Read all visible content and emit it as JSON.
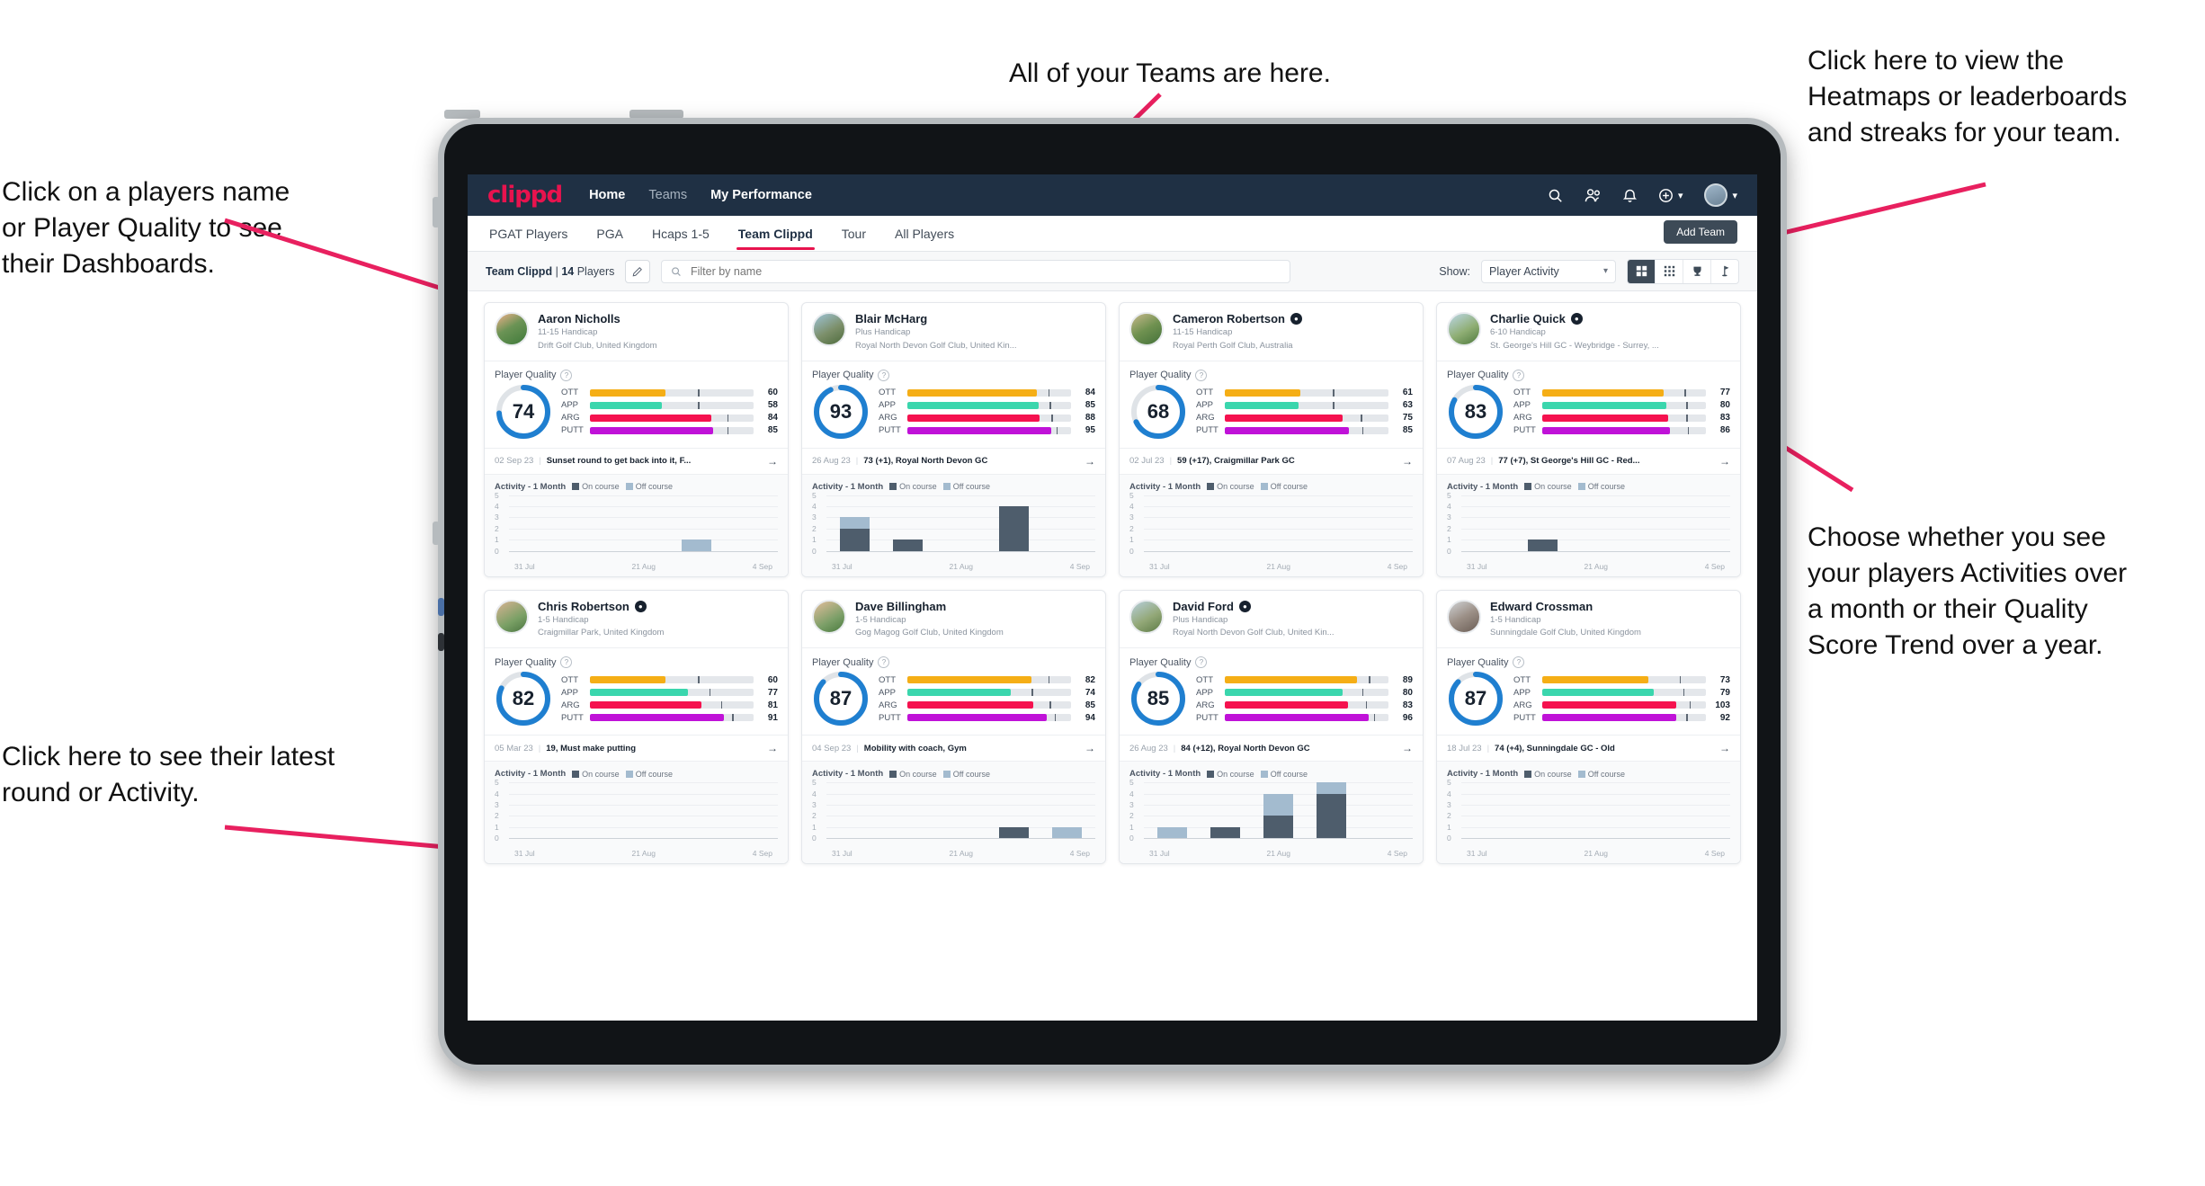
{
  "annotations": [
    {
      "id": "teams",
      "text": "All of your Teams are here."
    },
    {
      "id": "heatmaps",
      "text": "Click here to view the\nHeatmaps or leaderboards\nand streaks for your team."
    },
    {
      "id": "players",
      "text": "Click on a players name\nor Player Quality to see\ntheir Dashboards."
    },
    {
      "id": "choose",
      "text": "Choose whether you see\nyour players Activities over\na month or their Quality\nScore Trend over a year."
    },
    {
      "id": "latest",
      "text": "Click here to see their latest\nround or Activity."
    }
  ],
  "app": {
    "brand": "clippd",
    "brand_color": "#e8134e",
    "header_bg": "#1f3044",
    "nav": [
      {
        "label": "Home",
        "active": true
      },
      {
        "label": "Teams",
        "active": false
      },
      {
        "label": "My Performance",
        "active": false
      }
    ],
    "header_icons": [
      {
        "name": "search-icon",
        "glyph": "⌕"
      },
      {
        "name": "people-icon",
        "glyph": "\u0000"
      },
      {
        "name": "bell-icon",
        "glyph": "\u0000"
      },
      {
        "name": "add-circle-icon",
        "glyph": "\u0000"
      },
      {
        "name": "avatar",
        "glyph": "\u0000"
      }
    ],
    "tabs": [
      {
        "label": "PGAT Players",
        "active": false
      },
      {
        "label": "PGA",
        "active": false
      },
      {
        "label": "Hcaps 1-5",
        "active": false
      },
      {
        "label": "Team Clippd",
        "active": true
      },
      {
        "label": "Tour",
        "active": false
      },
      {
        "label": "All Players",
        "active": false
      }
    ],
    "add_team_label": "Add Team",
    "filter": {
      "team_name": "Team Clippd",
      "separator": "|",
      "player_count": "14",
      "players_word": "Players",
      "search_placeholder": "Filter by name",
      "search_value": "",
      "show_label": "Show:",
      "show_selected": "Player Activity",
      "show_options": [
        "Player Activity",
        "Quality Score Trend"
      ],
      "view_modes": [
        {
          "name": "grid-large-icon",
          "active": true
        },
        {
          "name": "grid-small-icon",
          "active": false
        },
        {
          "name": "trophy-icon",
          "active": false
        },
        {
          "name": "flag-icon",
          "active": false
        }
      ]
    },
    "card_labels": {
      "player_quality": "Player Quality",
      "activity": "Activity - 1 Month",
      "legend_on": "On course",
      "legend_off": "Off course",
      "y_ticks": [
        "5",
        "4",
        "3",
        "2",
        "1",
        "0"
      ],
      "x_ticks": [
        "31 Jul",
        "21 Aug",
        "4 Sep"
      ],
      "metric_order": [
        "OTT",
        "APP",
        "ARG",
        "PUTT"
      ],
      "metric_colors": {
        "OTT": "#f5ae16",
        "APP": "#3ad6ad",
        "ARG": "#f5124f",
        "PUTT": "#c012d8"
      },
      "on_course_color": "#4e5d6c",
      "off_course_color": "#a3bbcf",
      "ring_color": "#1f7fd0",
      "ring_track": "#dfe3e7"
    }
  },
  "players": [
    {
      "name": "Aaron Nicholls",
      "verified": false,
      "handicap": "11-15 Handicap",
      "club": "Drift Golf Club, United Kingdom",
      "avatar": "linear-gradient(150deg,#f0b08a 0%,#6b9355 45%,#3f7a3a 100%)",
      "quality": 74,
      "metrics": [
        {
          "label": "OTT",
          "value": 60,
          "fill": 46,
          "tick": 66
        },
        {
          "label": "APP",
          "value": 58,
          "fill": 44,
          "tick": 66
        },
        {
          "label": "ARG",
          "value": 84,
          "fill": 74,
          "tick": 84
        },
        {
          "label": "PUTT",
          "value": 85,
          "fill": 75,
          "tick": 84
        }
      ],
      "latest_date": "02 Sep 23",
      "latest_text": "Sunset round to get back into it, F...",
      "activity": [
        {
          "on": 0,
          "off": 0
        },
        {
          "on": 0,
          "off": 0
        },
        {
          "on": 0,
          "off": 0
        },
        {
          "on": 0,
          "off": 1
        },
        {
          "on": 0,
          "off": 0
        }
      ]
    },
    {
      "name": "Blair McHarg",
      "verified": false,
      "handicap": "Plus Handicap",
      "club": "Royal North Devon Golf Club, United Kin...",
      "avatar": "linear-gradient(150deg,#9ec4d8 0%,#7c8f6a 55%,#4d6b3c 100%)",
      "quality": 93,
      "metrics": [
        {
          "label": "OTT",
          "value": 84,
          "fill": 79,
          "tick": 86
        },
        {
          "label": "APP",
          "value": 85,
          "fill": 80,
          "tick": 87
        },
        {
          "label": "ARG",
          "value": 88,
          "fill": 81,
          "tick": 88
        },
        {
          "label": "PUTT",
          "value": 95,
          "fill": 88,
          "tick": 91
        }
      ],
      "latest_date": "26 Aug 23",
      "latest_text": "73 (+1), Royal North Devon GC",
      "activity": [
        {
          "on": 2,
          "off": 1
        },
        {
          "on": 1,
          "off": 0
        },
        {
          "on": 0,
          "off": 0
        },
        {
          "on": 4,
          "off": 0
        },
        {
          "on": 0,
          "off": 0
        }
      ]
    },
    {
      "name": "Cameron Robertson",
      "verified": true,
      "handicap": "11-15 Handicap",
      "club": "Royal Perth Golf Club, Australia",
      "avatar": "linear-gradient(150deg,#c9b98d 0%,#6f9150 50%,#44713a 100%)",
      "quality": 68,
      "metrics": [
        {
          "label": "OTT",
          "value": 61,
          "fill": 46,
          "tick": 66
        },
        {
          "label": "APP",
          "value": 63,
          "fill": 45,
          "tick": 66
        },
        {
          "label": "ARG",
          "value": 75,
          "fill": 72,
          "tick": 83
        },
        {
          "label": "PUTT",
          "value": 85,
          "fill": 76,
          "tick": 84
        }
      ],
      "latest_date": "02 Jul 23",
      "latest_text": "59 (+17), Craigmillar Park GC",
      "activity": [
        {
          "on": 0,
          "off": 0
        },
        {
          "on": 0,
          "off": 0
        },
        {
          "on": 0,
          "off": 0
        },
        {
          "on": 0,
          "off": 0
        },
        {
          "on": 0,
          "off": 0
        }
      ]
    },
    {
      "name": "Charlie Quick",
      "verified": true,
      "handicap": "6-10 Handicap",
      "club": "St. George's Hill GC - Weybridge - Surrey, ...",
      "avatar": "linear-gradient(150deg,#bcd7e8 0%,#8fae74 55%,#4f7a3e 100%)",
      "quality": 83,
      "metrics": [
        {
          "label": "OTT",
          "value": 77,
          "fill": 74,
          "tick": 87
        },
        {
          "label": "APP",
          "value": 80,
          "fill": 76,
          "tick": 88
        },
        {
          "label": "ARG",
          "value": 83,
          "fill": 77,
          "tick": 88
        },
        {
          "label": "PUTT",
          "value": 86,
          "fill": 78,
          "tick": 89
        }
      ],
      "latest_date": "07 Aug 23",
      "latest_text": "77 (+7), St George's Hill GC - Red...",
      "activity": [
        {
          "on": 0,
          "off": 0
        },
        {
          "on": 1,
          "off": 0
        },
        {
          "on": 0,
          "off": 0
        },
        {
          "on": 0,
          "off": 0
        },
        {
          "on": 0,
          "off": 0
        }
      ]
    },
    {
      "name": "Chris Robertson",
      "verified": true,
      "handicap": "1-5 Handicap",
      "club": "Craigmillar Park, United Kingdom",
      "avatar": "linear-gradient(150deg,#d9b394 0%,#7aa065 60%,#4a7440 100%)",
      "quality": 82,
      "metrics": [
        {
          "label": "OTT",
          "value": 60,
          "fill": 46,
          "tick": 66
        },
        {
          "label": "APP",
          "value": 77,
          "fill": 60,
          "tick": 73
        },
        {
          "label": "ARG",
          "value": 81,
          "fill": 68,
          "tick": 80
        },
        {
          "label": "PUTT",
          "value": 91,
          "fill": 82,
          "tick": 87
        }
      ],
      "latest_date": "05 Mar 23",
      "latest_text": "19, Must make putting",
      "activity": [
        {
          "on": 0,
          "off": 0
        },
        {
          "on": 0,
          "off": 0
        },
        {
          "on": 0,
          "off": 0
        },
        {
          "on": 0,
          "off": 0
        },
        {
          "on": 0,
          "off": 0
        }
      ]
    },
    {
      "name": "Dave Billingham",
      "verified": false,
      "handicap": "1-5 Handicap",
      "club": "Gog Magog Golf Club, United Kingdom",
      "avatar": "linear-gradient(150deg,#e3bd9c 0%,#7c9f68 60%,#4a7a3e 100%)",
      "quality": 87,
      "metrics": [
        {
          "label": "OTT",
          "value": 82,
          "fill": 76,
          "tick": 86
        },
        {
          "label": "APP",
          "value": 74,
          "fill": 63,
          "tick": 76
        },
        {
          "label": "ARG",
          "value": 85,
          "fill": 77,
          "tick": 87
        },
        {
          "label": "PUTT",
          "value": 94,
          "fill": 85,
          "tick": 90
        }
      ],
      "latest_date": "04 Sep 23",
      "latest_text": "Mobility with coach, Gym",
      "activity": [
        {
          "on": 0,
          "off": 0
        },
        {
          "on": 0,
          "off": 0
        },
        {
          "on": 0,
          "off": 0
        },
        {
          "on": 1,
          "off": 0
        },
        {
          "on": 0,
          "off": 1
        }
      ]
    },
    {
      "name": "David Ford",
      "verified": true,
      "handicap": "Plus Handicap",
      "club": "Royal North Devon Golf Club, United Kin...",
      "avatar": "linear-gradient(150deg,#b7cfdd 0%,#93a878 55%,#5d7b46 100%)",
      "quality": 85,
      "metrics": [
        {
          "label": "OTT",
          "value": 89,
          "fill": 81,
          "tick": 88
        },
        {
          "label": "APP",
          "value": 80,
          "fill": 72,
          "tick": 84
        },
        {
          "label": "ARG",
          "value": 83,
          "fill": 75,
          "tick": 86
        },
        {
          "label": "PUTT",
          "value": 96,
          "fill": 88,
          "tick": 91
        }
      ],
      "latest_date": "26 Aug 23",
      "latest_text": "84 (+12), Royal North Devon GC",
      "activity": [
        {
          "on": 0,
          "off": 1
        },
        {
          "on": 1,
          "off": 0
        },
        {
          "on": 2,
          "off": 2
        },
        {
          "on": 4,
          "off": 1
        },
        {
          "on": 0,
          "off": 0
        }
      ]
    },
    {
      "name": "Edward Crossman",
      "verified": false,
      "handicap": "1-5 Handicap",
      "club": "Sunningdale Golf Club, United Kingdom",
      "avatar": "linear-gradient(150deg,#d0d3d6 0%,#9b8f86 50%,#6a5d55 100%)",
      "quality": 87,
      "metrics": [
        {
          "label": "OTT",
          "value": 73,
          "fill": 65,
          "tick": 84
        },
        {
          "label": "APP",
          "value": 79,
          "fill": 68,
          "tick": 86
        },
        {
          "label": "ARG",
          "value": 103,
          "fill": 82,
          "tick": 90
        },
        {
          "label": "PUTT",
          "value": 92,
          "fill": 82,
          "tick": 88
        }
      ],
      "latest_date": "18 Jul 23",
      "latest_text": "74 (+4), Sunningdale GC - Old",
      "activity": [
        {
          "on": 0,
          "off": 0
        },
        {
          "on": 0,
          "off": 0
        },
        {
          "on": 0,
          "off": 0
        },
        {
          "on": 0,
          "off": 0
        },
        {
          "on": 0,
          "off": 0
        }
      ]
    }
  ]
}
